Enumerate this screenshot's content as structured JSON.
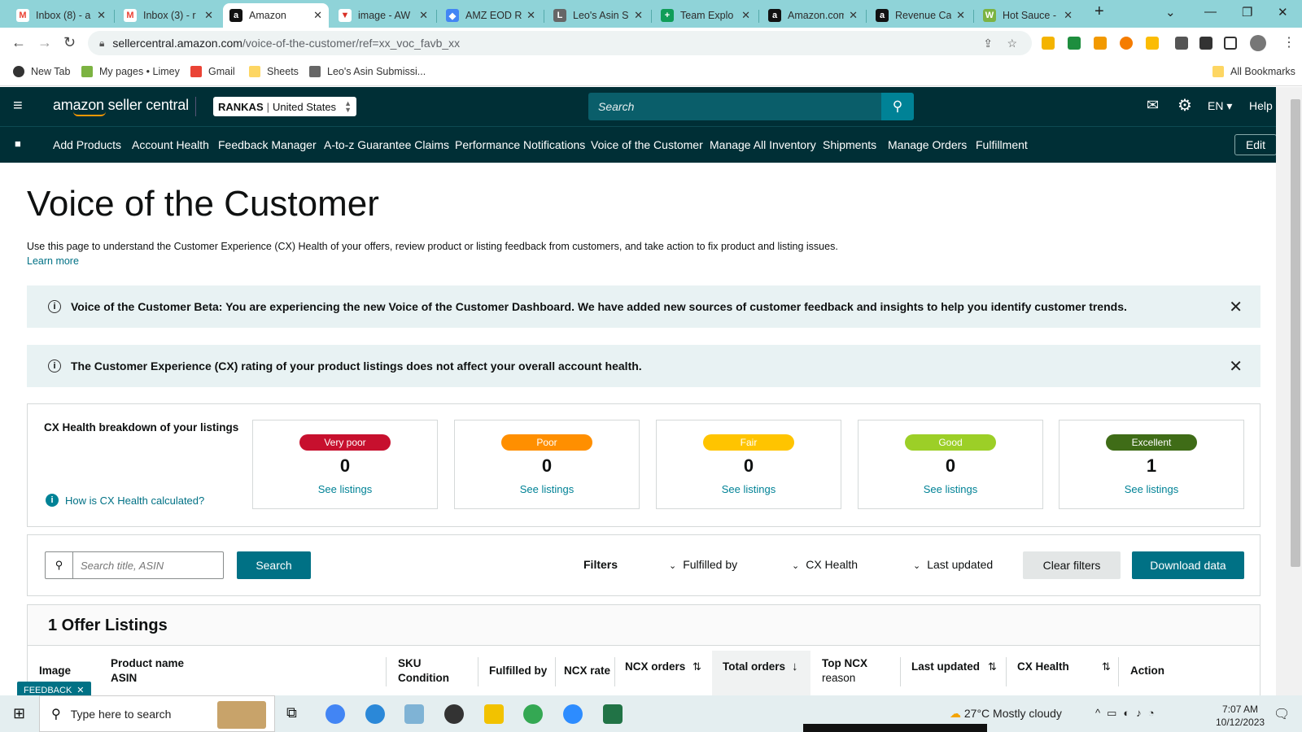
{
  "browser": {
    "tabs": [
      {
        "title": "Inbox (8) - a",
        "fav_color": "#ea4335",
        "fav_char": "M"
      },
      {
        "title": "Inbox (3) - r",
        "fav_color": "#ea4335",
        "fav_char": "M"
      },
      {
        "title": "Amazon",
        "fav_color": "#111",
        "fav_char": "a"
      },
      {
        "title": "image - AW",
        "fav_color": "#d93025",
        "fav_char": "▼"
      },
      {
        "title": "AMZ EOD R",
        "fav_color": "#4285f4",
        "fav_char": "◆"
      },
      {
        "title": "Leo's Asin S",
        "fav_color": "#555",
        "fav_char": "L"
      },
      {
        "title": "Team Explo",
        "fav_color": "#0f9d58",
        "fav_char": "+"
      },
      {
        "title": "Amazon.com",
        "fav_color": "#111",
        "fav_char": "a"
      },
      {
        "title": "Revenue Ca",
        "fav_color": "#111",
        "fav_char": "a"
      },
      {
        "title": "Hot Sauce -",
        "fav_color": "#7cb342",
        "fav_char": "W"
      }
    ],
    "url_host": "sellercentral.amazon.com",
    "url_path": "/voice-of-the-customer/ref=xx_voc_favb_xx",
    "bookmarks": [
      "New Tab",
      "My pages • Limey",
      "Gmail",
      "Sheets",
      "Leo's Asin Submissi..."
    ],
    "all_bookmarks": "All Bookmarks"
  },
  "header": {
    "logo": "amazon seller central",
    "store": "RANKAS",
    "marketplace": "United States",
    "search_placeholder": "Search",
    "lang": "EN",
    "help": "Help"
  },
  "nav": {
    "items": [
      "Add Products",
      "Account Health",
      "Feedback Manager",
      "A-to-z Guarantee Claims",
      "Performance Notifications",
      "Voice of the Customer",
      "Manage All Inventory",
      "Shipments",
      "Manage Orders",
      "Fulfillment"
    ],
    "edit": "Edit"
  },
  "page": {
    "title": "Voice of the Customer",
    "description": "Use this page to understand the Customer Experience (CX) Health of your offers, review product or listing feedback from customers, and take action to fix product and listing issues.",
    "learn_more": "Learn more",
    "banner1": "Voice of the Customer Beta: You are experiencing the new Voice of the Customer Dashboard. We have added new sources of customer feedback and insights to help you identify customer trends.",
    "banner2": "The Customer Experience (CX) rating of your product listings does not affect your overall account health."
  },
  "health": {
    "title": "CX Health breakdown of your listings",
    "how_link": "How is CX Health calculated?",
    "see_listings": "See listings",
    "categories": [
      {
        "label": "Very poor",
        "count": "0",
        "color": "#c7102e"
      },
      {
        "label": "Poor",
        "count": "0",
        "color": "#ff8f00"
      },
      {
        "label": "Fair",
        "count": "0",
        "color": "#ffc400"
      },
      {
        "label": "Good",
        "count": "0",
        "color": "#9ccf27"
      },
      {
        "label": "Excellent",
        "count": "1",
        "color": "#3f6c17"
      }
    ]
  },
  "filters": {
    "search_placeholder": "Search title, ASIN",
    "search_button": "Search",
    "filters_label": "Filters",
    "fulfilled_by": "Fulfilled by",
    "cx_health": "CX Health",
    "last_updated": "Last updated",
    "clear": "Clear filters",
    "download": "Download data"
  },
  "listings": {
    "title": "1 Offer Listings",
    "columns": {
      "image": "Image",
      "product_name": "Product name",
      "asin": "ASIN",
      "sku": "SKU",
      "condition": "Condition",
      "fulfilled_by": "Fulfilled by",
      "ncx_rate": "NCX rate",
      "ncx_orders": "NCX orders",
      "total_orders": "Total orders",
      "top_ncx": "Top NCX",
      "reason": "reason",
      "last_updated": "Last updated",
      "cx_health": "CX Health",
      "action": "Action"
    }
  },
  "feedback_tab": "FEEDBACK",
  "taskbar": {
    "search": "Type here to search",
    "weather": "27°C  Mostly cloudy",
    "time": "7:07 AM",
    "date": "10/12/2023"
  }
}
